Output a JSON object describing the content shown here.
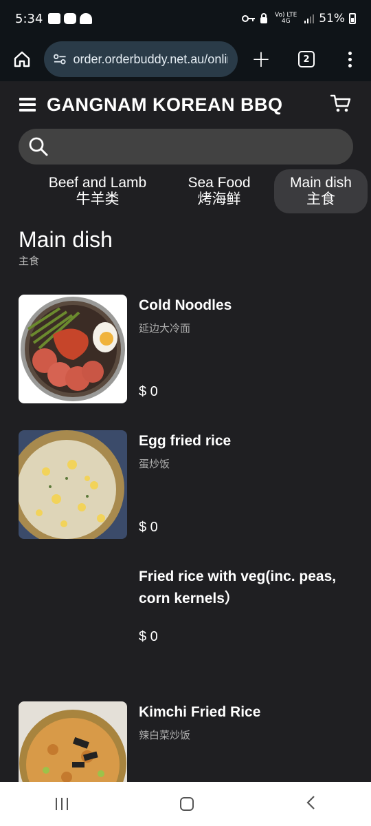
{
  "status_bar": {
    "time": "5:34",
    "network": "Vo) LTE 4G",
    "battery": "51%"
  },
  "browser": {
    "url": "order.orderbuddy.net.au/online",
    "tab_count": "2"
  },
  "header": {
    "title": "GANGNAM KOREAN BBQ"
  },
  "search": {
    "placeholder": ""
  },
  "categories": [
    {
      "label": "Beef and Lamb",
      "sub": "牛羊类"
    },
    {
      "label": "Sea Food",
      "sub": "烤海鲜"
    },
    {
      "label": "Main dish",
      "sub": "主食",
      "active": true
    }
  ],
  "section": {
    "title": "Main dish",
    "subtitle": "主食"
  },
  "items": [
    {
      "name": "Cold Noodles",
      "name_cn": "延边大冷面",
      "price": "$ 0"
    },
    {
      "name": "Egg fried rice",
      "name_cn": "蛋炒饭",
      "price": "$ 0"
    },
    {
      "name": "Fried rice with veg(inc. peas, corn kernels）",
      "name_cn": "",
      "price": "$ 0"
    },
    {
      "name": "Kimchi Fried Rice",
      "name_cn": "辣白菜炒饭",
      "price": ""
    }
  ],
  "colors": {
    "background": "#1f1f22",
    "chip_active": "#3b3b3e",
    "search_bg": "#424242",
    "url_bg": "#2a3b48"
  }
}
